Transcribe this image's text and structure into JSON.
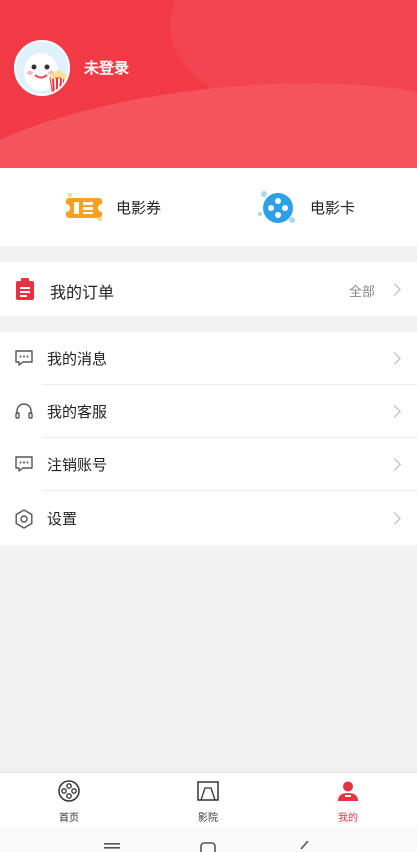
{
  "header": {
    "login_status": "未登录",
    "avatar_icon": "popcorn-mascot-icon",
    "brand_color": "#f23a47"
  },
  "quick_links": [
    {
      "label": "电影券",
      "icon": "ticket-voucher-icon"
    },
    {
      "label": "电影卡",
      "icon": "film-card-icon"
    }
  ],
  "orders": {
    "title": "我的订单",
    "all_label": "全部",
    "icon": "clipboard-icon"
  },
  "menu": [
    {
      "label": "我的消息",
      "icon": "message-icon"
    },
    {
      "label": "我的客服",
      "icon": "headset-icon"
    },
    {
      "label": "注销账号",
      "icon": "message-icon"
    },
    {
      "label": "设置",
      "icon": "settings-icon"
    }
  ],
  "tabs": [
    {
      "label": "首页",
      "icon": "film-reel-icon",
      "active": false
    },
    {
      "label": "影院",
      "icon": "screen-icon",
      "active": false
    },
    {
      "label": "我的",
      "icon": "user-icon",
      "active": true
    }
  ],
  "colors": {
    "active_tab": "#e8323f",
    "voucher_orange": "#f7a021",
    "card_blue": "#2d9fe8"
  }
}
